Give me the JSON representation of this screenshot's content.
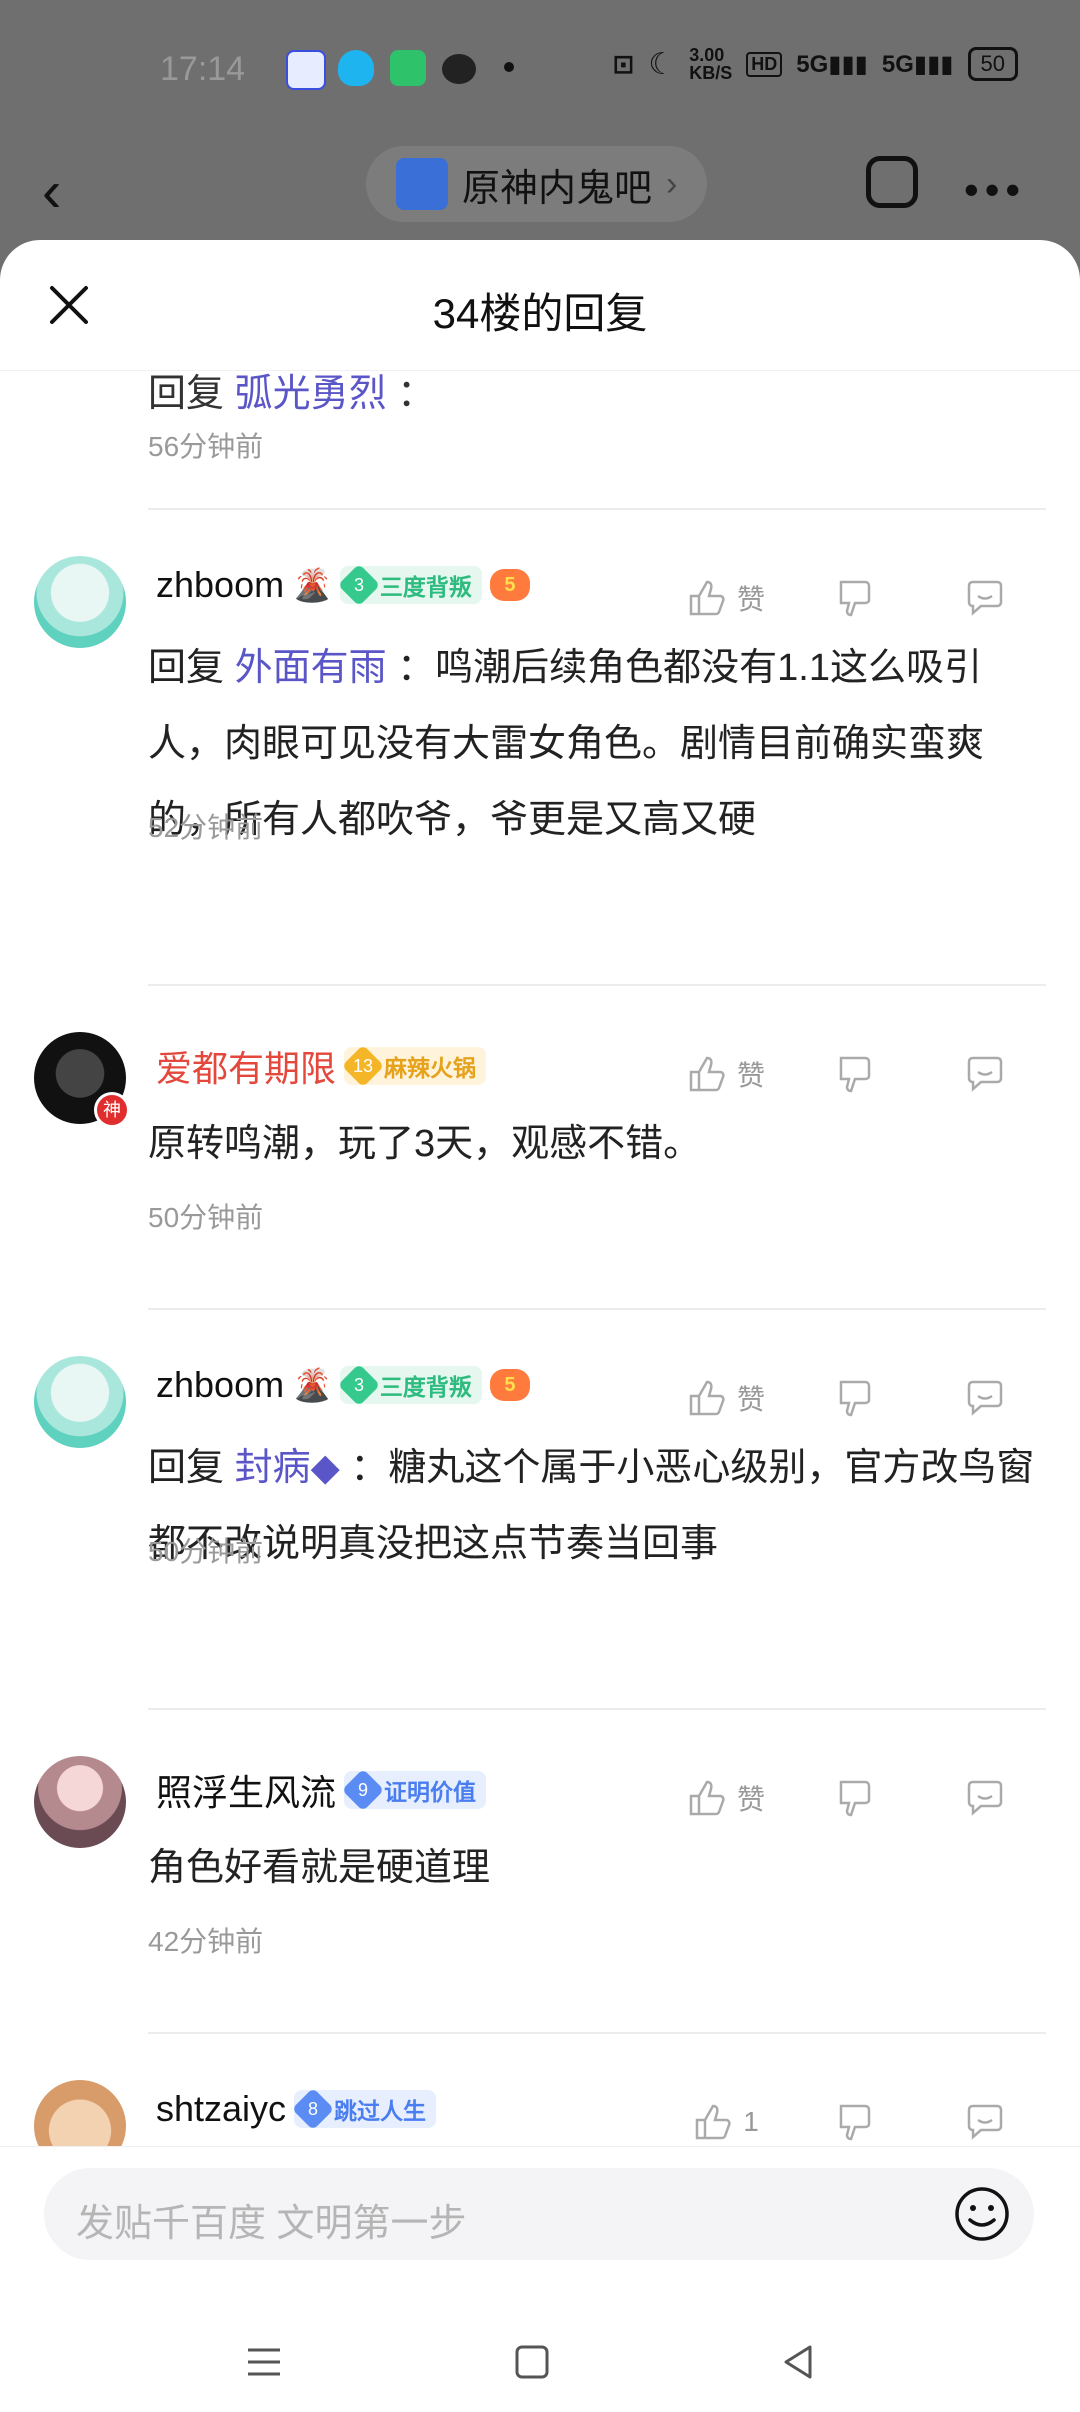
{
  "status_bar": {
    "time": "17:14",
    "network_speed": "3.00\nKB/S",
    "battery": "50"
  },
  "nav": {
    "forum_name": "原神内鬼吧"
  },
  "sheet": {
    "title": "34楼的回复"
  },
  "partial": {
    "prefix": "回复",
    "reply_to": "弧光勇烈",
    "suffix": "：",
    "time": "56分钟前"
  },
  "comments": [
    {
      "username": "zhboom",
      "user_emoji": "🌋",
      "level": "3",
      "badge": "三度背叛",
      "extra_badge": "5",
      "like_label": "赞",
      "reply_prefix": "回复",
      "reply_to": "外面有雨",
      "text": "：鸣潮后续角色都没有1.1这么吸引人，肉眼可见没有大雷女角色。剧情目前确实蛮爽的，所有人都吹爷，爷更是又高又硬",
      "time": "52分钟前"
    },
    {
      "username": "爱都有期限",
      "avatar_badge": "神",
      "level": "13",
      "badge": "麻辣火锅",
      "like_label": "赞",
      "text": "原转鸣潮，玩了3天，观感不错。",
      "time": "50分钟前"
    },
    {
      "username": "zhboom",
      "user_emoji": "🌋",
      "level": "3",
      "badge": "三度背叛",
      "extra_badge": "5",
      "like_label": "赞",
      "reply_prefix": "回复",
      "reply_to": "封病◆",
      "text": "：糖丸这个属于小恶心级别，官方改鸟窗都不改说明真没把这点节奏当回事",
      "time": "50分钟前"
    },
    {
      "username": "照浮生风流",
      "level": "9",
      "badge": "证明价值",
      "like_label": "赞",
      "text": "角色好看就是硬道理",
      "time": "42分钟前"
    },
    {
      "username": "shtzaiyc",
      "level": "8",
      "badge": "跳过人生",
      "like_label": "1"
    }
  ],
  "input": {
    "placeholder": "发贴千百度 文明第一步"
  },
  "colors": {
    "link": "#5b56c8",
    "red_name": "#e4473c",
    "muted": "#999999"
  }
}
